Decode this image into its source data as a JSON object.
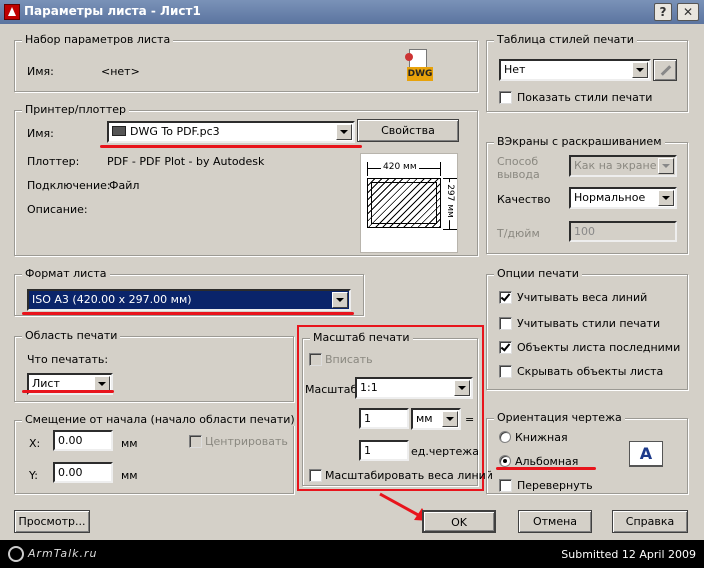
{
  "window": {
    "title": "Параметры листа - Лист1",
    "help_label": "?",
    "close_label": "✕"
  },
  "page_setup": {
    "group_title": "Набор параметров листа",
    "name_label": "Имя:",
    "name_value": "<нет>",
    "icon_text": "DWG"
  },
  "printer": {
    "group_title": "Принтер/плоттер",
    "name_label": "Имя:",
    "device": "DWG To PDF.pc3",
    "properties_button": "Свойства",
    "plotter_label": "Плоттер:",
    "plotter_value": "PDF - PDF Plot - by Autodesk",
    "connection_label": "Подключение:",
    "connection_value": "Файл",
    "description_label": "Описание:",
    "preview_width": "420 мм",
    "preview_height": "297 мм"
  },
  "paper_size": {
    "group_title": "Формат листа",
    "value": "ISO A3 (420.00 x 297.00 мм)"
  },
  "plot_area": {
    "group_title": "Область печати",
    "what_label": "Что печатать:",
    "value": "Лист"
  },
  "offset": {
    "group_title": "Смещение от начала (начало области печати)",
    "x_label": "X:",
    "x_value": "0.00",
    "x_unit": "мм",
    "y_label": "Y:",
    "y_value": "0.00",
    "y_unit": "мм",
    "center_label": "Центрировать"
  },
  "scale": {
    "group_title": "Масштаб печати",
    "fit_label": "Вписать",
    "scale_label": "Масштаб:",
    "scale_value": "1:1",
    "units_value": "1",
    "units_type": "мм",
    "equals": "=",
    "drawing_units_value": "1",
    "drawing_units_label": "ед.чертежа",
    "lineweights_label": "Масштабировать веса линий"
  },
  "plot_style": {
    "group_title": "Таблица стилей печати",
    "value": "Нет",
    "show_styles_label": "Показать стили печати"
  },
  "shaded": {
    "group_title": "ВЭкраны с раскрашиванием",
    "output_label": "Способ вывода",
    "output_value": "Как на экране",
    "quality_label": "Качество",
    "quality_value": "Нормальное",
    "dpi_label": "Т/дюйм",
    "dpi_value": "100"
  },
  "options": {
    "group_title": "Опции печати",
    "items": [
      {
        "label": "Учитывать веса линий",
        "checked": true
      },
      {
        "label": "Учитывать стили печати",
        "checked": false
      },
      {
        "label": "Объекты листа последними",
        "checked": true
      },
      {
        "label": "Скрывать объекты листа",
        "checked": false
      }
    ]
  },
  "orientation": {
    "group_title": "Ориентация чертежа",
    "portrait_label": "Книжная",
    "landscape_label": "Альбомная",
    "upside_label": "Перевернуть",
    "selected": "landscape",
    "icon_letter": "A"
  },
  "buttons": {
    "preview": "Просмотр...",
    "ok": "OK",
    "cancel": "Отмена",
    "help": "Справка"
  },
  "footer": {
    "logo_text": "ArmTalk.ru",
    "submitted": "Submitted 12 April 2009"
  },
  "colors": {
    "highlight": "#0a246a",
    "annotation_red": "#e8141c",
    "title_bar": "#6a82ad"
  }
}
